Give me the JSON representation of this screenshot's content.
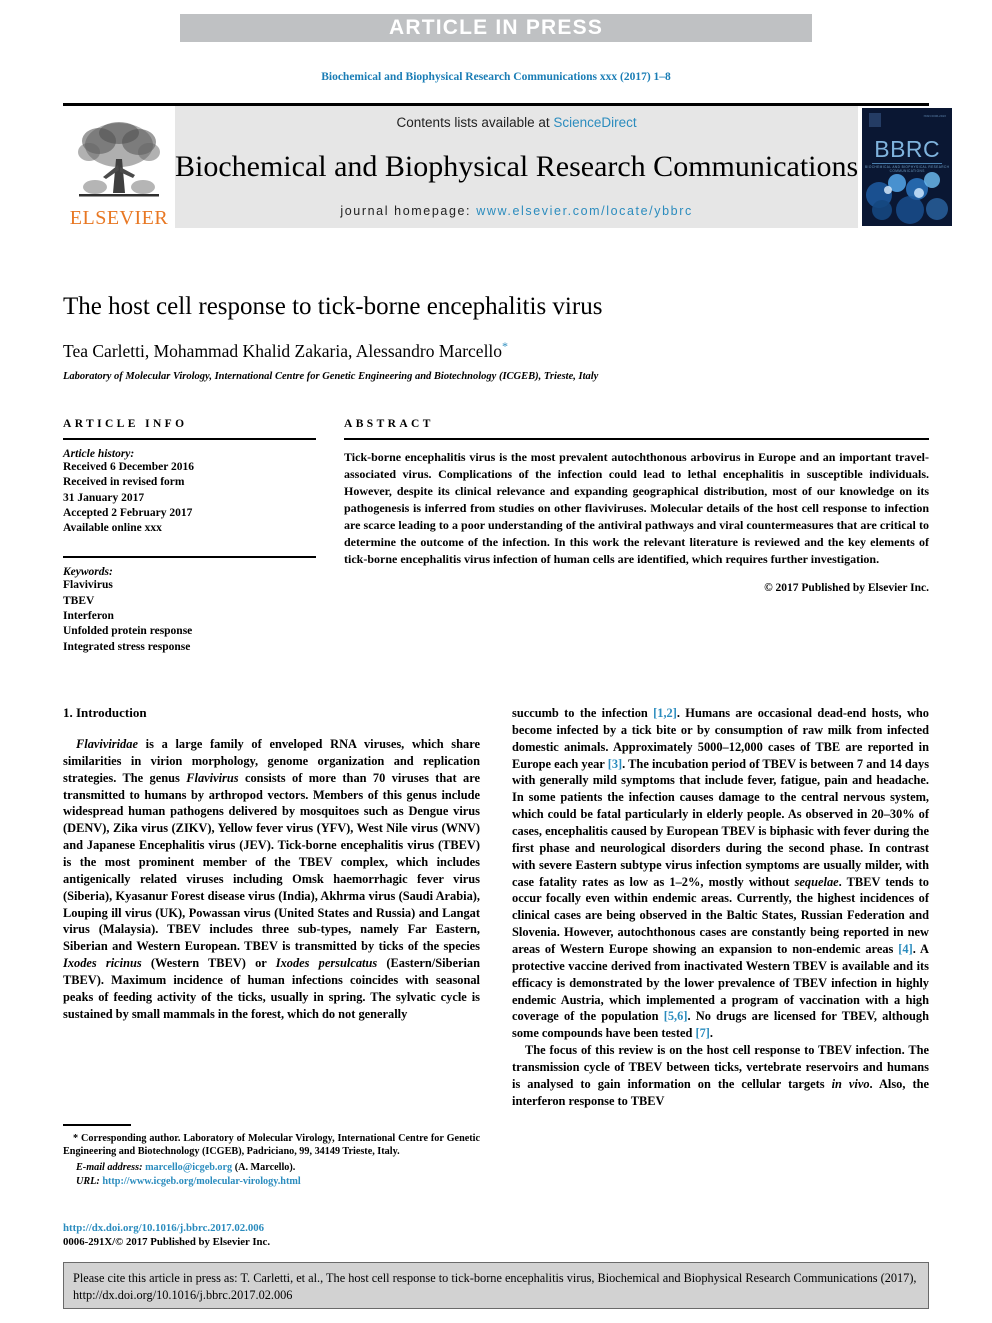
{
  "banner": {
    "label": "ARTICLE IN PRESS"
  },
  "running_head": "Biochemical and Biophysical Research Communications xxx (2017) 1–8",
  "masthead": {
    "contents_prefix": "Contents lists available at ",
    "sciencedirect": "ScienceDirect",
    "journal_title": "Biochemical and Biophysical Research Communications",
    "homepage_prefix": "journal homepage: ",
    "homepage_url": "www.elsevier.com/locate/ybbrc",
    "publisher_word": "ELSEVIER",
    "cover_title": "BBRC",
    "cover_subtitle": "BIOCHEMICAL AND BIOPHYSICAL RESEARCH COMMUNICATIONS",
    "cover_issn": "ISSN 0006-291X"
  },
  "article": {
    "title": "The host cell response to tick-borne encephalitis virus",
    "authors": "Tea Carletti, Mohammad Khalid Zakaria, Alessandro Marcello",
    "corresponding_marker": "*",
    "affiliation": "Laboratory of Molecular Virology, International Centre for Genetic Engineering and Biotechnology (ICGEB), Trieste, Italy"
  },
  "article_info": {
    "heading": "ARTICLE INFO",
    "history_label": "Article history:",
    "history_lines": [
      "Received 6 December 2016",
      "Received in revised form",
      "31 January 2017",
      "Accepted 2 February 2017",
      "Available online xxx"
    ],
    "keywords_label": "Keywords:",
    "keywords": [
      "Flavivirus",
      "TBEV",
      "Interferon",
      "Unfolded protein response",
      "Integrated stress response"
    ]
  },
  "abstract": {
    "heading": "ABSTRACT",
    "text": "Tick-borne encephalitis virus is the most prevalent autochthonous arbovirus in Europe and an important travel-associated virus. Complications of the infection could lead to lethal encephalitis in susceptible individuals. However, despite its clinical relevance and expanding geographical distribution, most of our knowledge on its pathogenesis is inferred from studies on other flaviviruses. Molecular details of the host cell response to infection are scarce leading to a poor understanding of the antiviral pathways and viral countermeasures that are critical to determine the outcome of the infection. In this work the relevant literature is reviewed and the key elements of tick-borne encephalitis virus infection of human cells are identified, which requires further investigation.",
    "copyright": "© 2017 Published by Elsevier Inc."
  },
  "introduction": {
    "section_number_title": "1. Introduction",
    "left_para_1_a": "Flaviviridae",
    "left_para_1_b": " is a large family of enveloped RNA viruses, which share similarities in virion morphology, genome organization and replication strategies. The genus ",
    "left_para_1_c": "Flavivirus",
    "left_para_1_d": " consists of more than 70 viruses that are transmitted to humans by arthropod vectors. Members of this genus include widespread human pathogens delivered by mosquitoes such as Dengue virus (DENV), Zika virus (ZIKV), Yellow fever virus (YFV), West Nile virus (WNV) and Japanese Encephalitis virus (JEV). Tick-borne encephalitis virus (TBEV) is the most prominent member of the TBEV complex, which includes antigenically related viruses including Omsk haemorrhagic fever virus (Siberia), Kyasanur Forest disease virus (India), Akhrma virus (Saudi Arabia), Louping ill virus (UK), Powassan virus (United States and Russia) and Langat virus (Malaysia). TBEV includes three sub-types, namely Far Eastern, Siberian and Western European. TBEV is transmitted by ticks of the species ",
    "left_para_1_e": "Ixodes ricinus",
    "left_para_1_f": " (Western TBEV) or ",
    "left_para_1_g": "Ixodes persulcatus",
    "left_para_1_h": " (Eastern/Siberian TBEV). Maximum incidence of human infections coincides with seasonal peaks of feeding activity of the ticks, usually in spring. The sylvatic cycle is sustained by small mammals in the forest, which do not generally",
    "right_para_1_a": "succumb to the infection ",
    "right_cite_1": "[1,2]",
    "right_para_1_b": ". Humans are occasional dead-end hosts, who become infected by a tick bite or by consumption of raw milk from infected domestic animals. Approximately 5000–12,000 cases of TBE are reported in Europe each year ",
    "right_cite_2": "[3]",
    "right_para_1_c": ". The incubation period of TBEV is between 7 and 14 days with generally mild symptoms that include fever, fatigue, pain and headache. In some patients the infection causes damage to the central nervous system, which could be fatal particularly in elderly people. As observed in 20–30% of cases, encephalitis caused by European TBEV is biphasic with fever during the first phase and neurological disorders during the second phase. In contrast with severe Eastern subtype virus infection symptoms are usually milder, with case fatality rates as low as 1–2%, mostly without ",
    "right_italic_1": "sequelae",
    "right_para_1_d": ". TBEV tends to occur focally even within endemic areas. Currently, the highest incidences of clinical cases are being observed in the Baltic States, Russian Federation and Slovenia. However, autochthonous cases are constantly being reported in new areas of Western Europe showing an expansion to non-endemic areas ",
    "right_cite_3": "[4]",
    "right_para_1_e": ". A protective vaccine derived from inactivated Western TBEV is available and its efficacy is demonstrated by the lower prevalence of TBEV infection in highly endemic Austria, which implemented a program of vaccination with a high coverage of the population ",
    "right_cite_4": "[5,6]",
    "right_para_1_f": ". No drugs are licensed for TBEV, although some compounds have been tested ",
    "right_cite_5": "[7]",
    "right_para_1_g": ".",
    "right_para_2_a": "The focus of this review is on the host cell response to TBEV infection. The transmission cycle of TBEV between ticks, vertebrate reservoirs and humans is analysed to gain information on the cellular targets ",
    "right_italic_2": "in vivo",
    "right_para_2_b": ". Also, the interferon response to TBEV"
  },
  "footnote": {
    "marker": "*",
    "text": " Corresponding author. Laboratory of Molecular Virology, International Centre for Genetic Engineering and Biotechnology (ICGEB), Padriciano, 99, 34149 Trieste, Italy.",
    "email_label": "E-mail address:",
    "email": "marcello@icgeb.org",
    "email_suffix": "(A. Marcello).",
    "url_label": "URL:",
    "url": "http://www.icgeb.org/molecular-virology.html",
    "doi": "http://dx.doi.org/10.1016/j.bbrc.2017.02.006",
    "issn_line": "0006-291X/© 2017 Published by Elsevier Inc."
  },
  "cite_box": {
    "text": "Please cite this article in press as: T. Carletti, et al., The host cell response to tick-borne encephalitis virus, Biochemical and Biophysical Research Communications (2017), http://dx.doi.org/10.1016/j.bbrc.2017.02.006"
  }
}
